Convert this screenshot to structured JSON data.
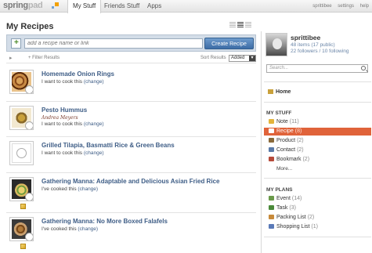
{
  "app": {
    "logo": "spring",
    "logo_accent": "pad"
  },
  "nav": {
    "tabs": [
      "My Stuff",
      "Friends Stuff",
      "Apps"
    ]
  },
  "top_links": [
    "sprittibee",
    "settings",
    "help"
  ],
  "page_title": "My Recipes",
  "add_bar": {
    "placeholder": "add a recipe name or link",
    "button": "Create Recipe"
  },
  "filters": {
    "filter_label": "Filter Results",
    "sort_label": "Sort Results",
    "sort_value": "Added"
  },
  "recipes": [
    {
      "title": "Homemade Onion Rings",
      "status": "I want to cook this",
      "change": "(change)"
    },
    {
      "title": "Pesto Hummus",
      "status": "I want to cook this",
      "change": "(change)",
      "script": "Andrea Meyers"
    },
    {
      "title": "Grilled Tilapia, Basmatti Rice & Green Beans",
      "status": "I want to cook this",
      "change": "(change)"
    },
    {
      "title": "Gathering Manna: Adaptable and Delicious Asian Fried Rice",
      "status": "I've cooked this",
      "change": "(change)"
    },
    {
      "title": "Gathering Manna: No More Boxed Falafels",
      "status": "I've cooked this",
      "change": "(change)"
    }
  ],
  "profile": {
    "name": "sprittibee",
    "items": "48 items (17 public)",
    "follow": "22 followers / 10 following"
  },
  "search": {
    "placeholder": "Search..."
  },
  "sidebar": {
    "home": "Home",
    "my_stuff_title": "MY STUFF",
    "my_stuff": [
      {
        "label": "Note",
        "count": "(11)",
        "color": "#e3b43b"
      },
      {
        "label": "Recipe",
        "count": "(8)",
        "color": "#ffffff"
      },
      {
        "label": "Product",
        "count": "(2)",
        "color": "#8a6a3a"
      },
      {
        "label": "Contact",
        "count": "(2)",
        "color": "#5a7aa8"
      },
      {
        "label": "Bookmark",
        "count": "(2)",
        "color": "#b64a3a"
      }
    ],
    "more": "More...",
    "my_plans_title": "MY PLANS",
    "my_plans": [
      {
        "label": "Event",
        "count": "(14)",
        "color": "#6a9a4a"
      },
      {
        "label": "Task",
        "count": "(3)",
        "color": "#4a8a3a"
      },
      {
        "label": "Packing List",
        "count": "(2)",
        "color": "#c78a3a"
      },
      {
        "label": "Shopping List",
        "count": "(1)",
        "color": "#5a7ab8"
      }
    ]
  },
  "accent_color": "#e0633a",
  "link_color": "#3e5d86"
}
